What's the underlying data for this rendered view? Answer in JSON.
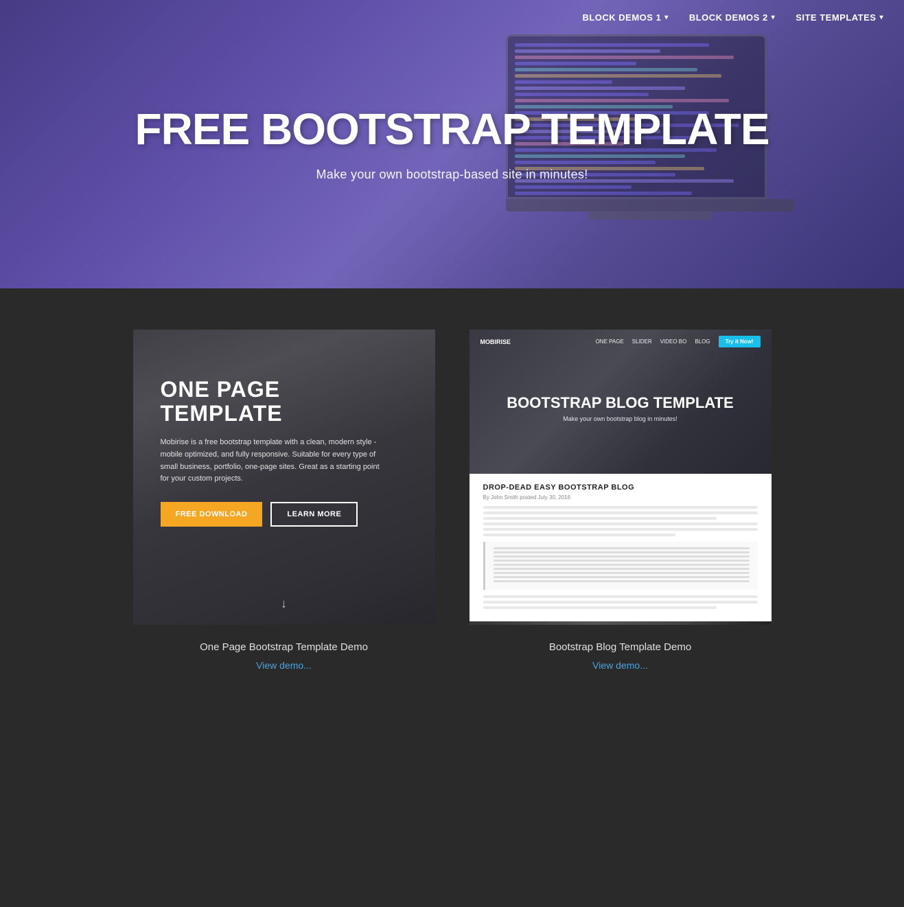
{
  "nav": {
    "items": [
      {
        "label": "BLOCK DEMOS 1",
        "hasDropdown": true
      },
      {
        "label": "BLOCK DEMOS 2",
        "hasDropdown": true
      },
      {
        "label": "SITE TEMPLATES",
        "hasDropdown": true
      }
    ]
  },
  "hero": {
    "title": "FREE BOOTSTRAP TEMPLATE",
    "subtitle": "Make your own bootstrap-based site in minutes!",
    "bg_color": "#6654b8"
  },
  "cards": [
    {
      "id": "one-page",
      "preview_title": "ONE PAGE TEMPLATE",
      "preview_text": "Mobirise is a free bootstrap template with a clean, modern style - mobile optimized, and fully responsive. Suitable for every type of small business, portfolio, one-page sites. Great as a starting point for your custom projects.",
      "btn_primary": "FREE DOWNLOAD",
      "btn_secondary": "LEARN MORE",
      "card_title": "One Page Bootstrap Template Demo",
      "card_link": "View demo..."
    },
    {
      "id": "blog",
      "blog_logo": "MOBIRISE",
      "blog_nav": [
        "ONE PAGE",
        "SLIDER",
        "VIDEO BO",
        "BLOG"
      ],
      "blog_cta": "Try it Now!",
      "blog_hero_title": "BOOTSTRAP BLOG TEMPLATE",
      "blog_hero_sub": "Make your own bootstrap blog in minutes!",
      "blog_article_title": "DROP-DEAD EASY BOOTSTRAP BLOG",
      "blog_article_meta": "By John Smith posted July 30, 2016",
      "card_title": "Bootstrap Blog Template Demo",
      "card_link": "View demo..."
    }
  ]
}
